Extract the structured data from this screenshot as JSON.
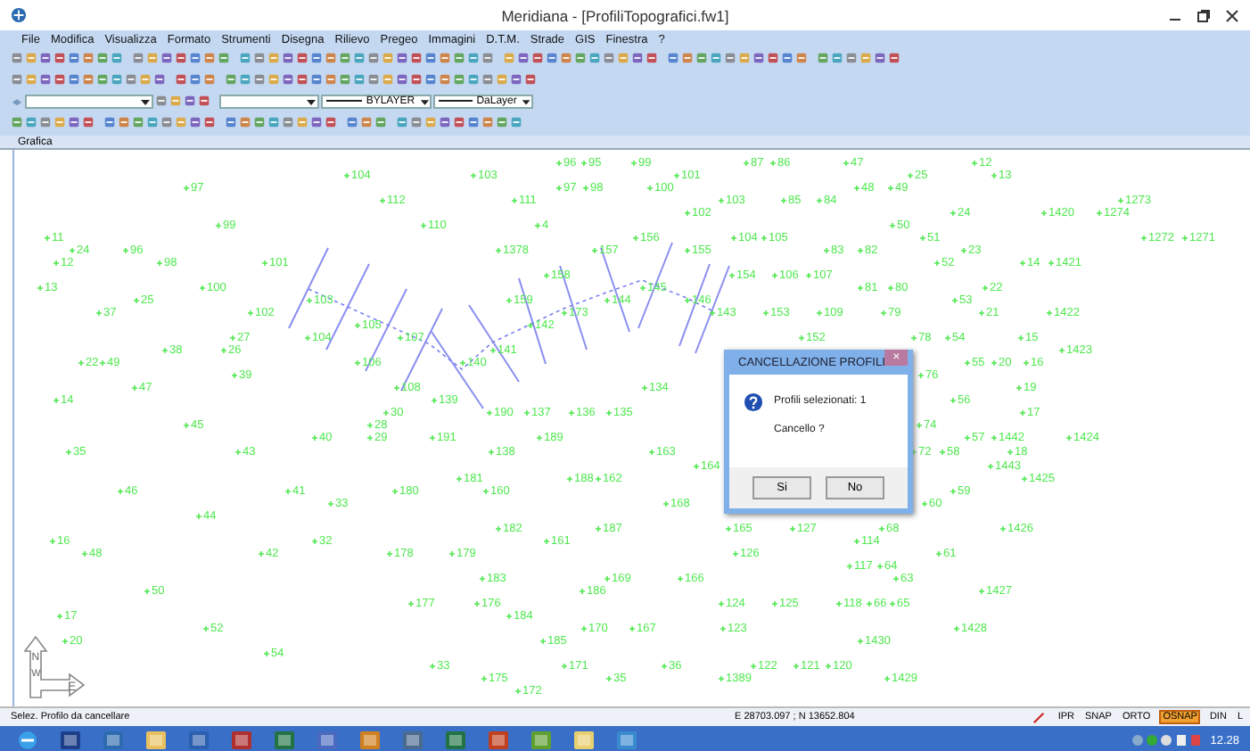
{
  "window": {
    "title": "Meridiana - [ProfiliTopografici.fw1]"
  },
  "menu": [
    "File",
    "Modifica",
    "Visualizza",
    "Formato",
    "Strumenti",
    "Disegna",
    "Rilievo",
    "Pregeo",
    "Immagini",
    "D.T.M.",
    "Strade",
    "GIS",
    "Finestra",
    "?"
  ],
  "properties_bar": {
    "linetype": "BYLAYER",
    "lineweight": "DaLayer"
  },
  "panel": {
    "title": "Grafica"
  },
  "points": [
    "96",
    "95",
    "99",
    "87",
    "86",
    "47",
    "12",
    "104",
    "103",
    "101",
    "25",
    "13",
    "97",
    "97",
    "98",
    "100",
    "48",
    "49",
    "112",
    "111",
    "103",
    "85",
    "84",
    "1273",
    "102",
    "24",
    "1420",
    "1274",
    "99",
    "110",
    "4",
    "50",
    "11",
    "156",
    "104",
    "105",
    "51",
    "1272",
    "1271",
    "24",
    "96",
    "1378",
    "157",
    "155",
    "83",
    "82",
    "23",
    "12",
    "98",
    "101",
    "52",
    "14",
    "1421",
    "158",
    "154",
    "106",
    "107",
    "13",
    "100",
    "145",
    "81",
    "80",
    "22",
    "25",
    "103",
    "159",
    "144",
    "146",
    "53",
    "37",
    "102",
    "173",
    "143",
    "153",
    "109",
    "79",
    "21",
    "1422",
    "105",
    "142",
    "27",
    "104",
    "107",
    "152",
    "78",
    "54",
    "15",
    "38",
    "26",
    "141",
    "1423",
    "22",
    "49",
    "106",
    "140",
    "55",
    "20",
    "16",
    "39",
    "76",
    "47",
    "108",
    "134",
    "19",
    "14",
    "139",
    "56",
    "30",
    "190",
    "137",
    "136",
    "135",
    "17",
    "45",
    "28",
    "74",
    "40",
    "29",
    "191",
    "189",
    "57",
    "1442",
    "1424",
    "35",
    "43",
    "138",
    "163",
    "72",
    "58",
    "18",
    "164",
    "1443",
    "181",
    "188",
    "162",
    "1425",
    "46",
    "41",
    "180",
    "160",
    "59",
    "33",
    "168",
    "60",
    "44",
    "182",
    "187",
    "165",
    "127",
    "68",
    "1426",
    "16",
    "32",
    "161",
    "114",
    "48",
    "42",
    "178",
    "179",
    "126",
    "61",
    "117",
    "64",
    "183",
    "169",
    "166",
    "63",
    "50",
    "186",
    "1427",
    "177",
    "176",
    "124",
    "125",
    "118",
    "66",
    "65",
    "17",
    "184",
    "52",
    "170",
    "167",
    "123",
    "1428",
    "20",
    "185",
    "1430",
    "54",
    "33",
    "171",
    "36",
    "122",
    "121",
    "120",
    "175",
    "35",
    "1389",
    "1429",
    "172"
  ],
  "compass": [
    "N",
    "W",
    "E"
  ],
  "dialog": {
    "title": "CANCELLAZIONE PROFILI",
    "close": "×",
    "message": "Profili selezionati: 1",
    "question": "Cancello ?",
    "buttons": [
      "Si",
      "No"
    ]
  },
  "status_bar": {
    "prompt": "Selez. Profilo da cancellare",
    "coordinates": "E 28703.097 ; N 13652.804",
    "toggles": [
      {
        "label": "IPR",
        "on": false
      },
      {
        "label": "SNAP",
        "on": false
      },
      {
        "label": "ORTO",
        "on": false
      },
      {
        "label": "OSNAP",
        "on": true
      },
      {
        "label": "DIN",
        "on": false
      },
      {
        "label": "L",
        "on": false
      }
    ]
  },
  "taskbar": {
    "time": "12.28"
  }
}
